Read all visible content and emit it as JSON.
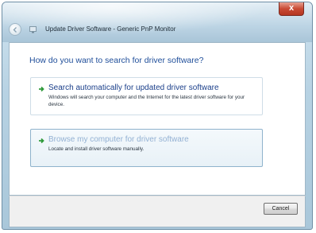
{
  "window": {
    "title": "Update Driver Software - Generic PnP Monitor",
    "close_label": "x"
  },
  "content": {
    "heading": "How do you want to search for driver software?",
    "options": [
      {
        "title": "Search automatically for updated driver software",
        "description": "Windows will search your computer and the Internet for the latest driver software for your device."
      },
      {
        "title": "Browse my computer for driver software",
        "description": "Locate and install driver software manually."
      }
    ]
  },
  "footer": {
    "cancel_label": "Cancel"
  },
  "icons": {
    "back": "back-arrow-icon",
    "device": "monitor-device-icon",
    "option_arrow": "green-arrow-icon",
    "close": "close-icon"
  },
  "colors": {
    "heading": "#1f4e9a",
    "option_title": "#1b3f8a",
    "option_arrow": "#2e9a3a",
    "close_button": "#c94a34"
  }
}
